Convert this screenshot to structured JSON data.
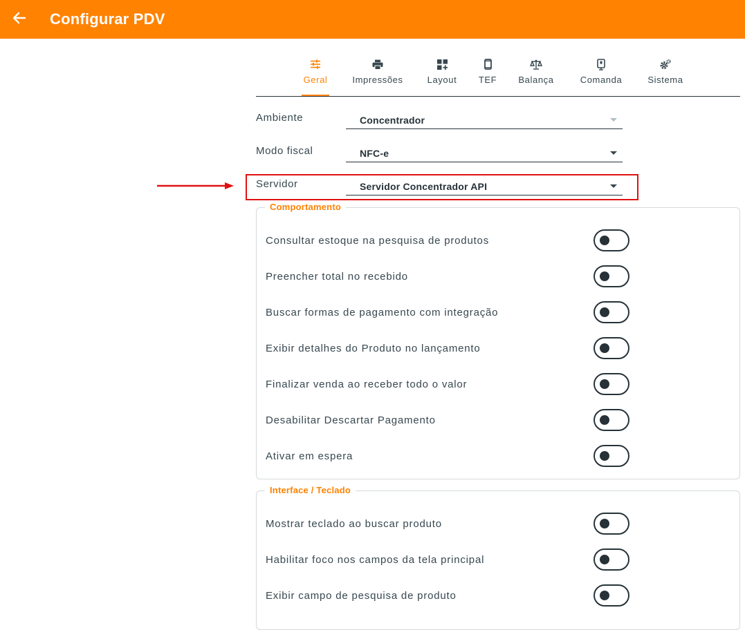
{
  "appbar": {
    "title": "Configurar PDV",
    "back_icon": "arrow-left-icon",
    "color": "#ff8200"
  },
  "tabs": [
    {
      "label": "Geral",
      "icon": "sliders-icon",
      "active": true
    },
    {
      "label": "Impressões",
      "icon": "printer-icon",
      "active": false
    },
    {
      "label": "Layout",
      "icon": "dashboard-icon",
      "active": false
    },
    {
      "label": "TEF",
      "icon": "phone-icon",
      "active": false
    },
    {
      "label": "Balança",
      "icon": "scale-icon",
      "active": false
    },
    {
      "label": "Comanda",
      "icon": "tablet-icon",
      "active": false
    },
    {
      "label": "Sistema",
      "icon": "gears-icon",
      "active": false
    }
  ],
  "form": {
    "ambiente": {
      "label": "Ambiente",
      "value": "Concentrador"
    },
    "modo_fiscal": {
      "label": "Modo fiscal",
      "value": "NFC-e"
    },
    "servidor": {
      "label": "Servidor",
      "value": "Servidor Concentrador API"
    }
  },
  "comportamento": {
    "title": "Comportamento",
    "options": [
      {
        "label": "Consultar estoque na pesquisa de produtos",
        "on": false
      },
      {
        "label": "Preencher total no recebido",
        "on": false
      },
      {
        "label": "Buscar formas de pagamento com integração",
        "on": false
      },
      {
        "label": "Exibir detalhes do Produto no lançamento",
        "on": false
      },
      {
        "label": "Finalizar venda ao receber todo o valor",
        "on": false
      },
      {
        "label": "Desabilitar Descartar Pagamento",
        "on": false
      },
      {
        "label": "Ativar em espera",
        "on": false
      }
    ]
  },
  "interface": {
    "title": "Interface / Teclado",
    "options": [
      {
        "label": "Mostrar teclado ao buscar produto",
        "on": false
      },
      {
        "label": "Habilitar foco nos campos da tela principal",
        "on": false
      },
      {
        "label": "Exibir campo de pesquisa de produto",
        "on": false
      }
    ]
  },
  "annotation": {
    "highlight_color": "#e01010"
  }
}
